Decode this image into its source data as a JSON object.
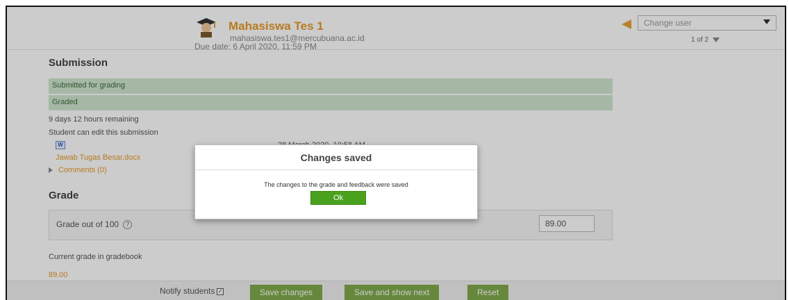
{
  "header": {
    "user_name": "Mahasiswa Tes 1",
    "user_email": "mahasiswa.tes1@mercubuana.ac.id",
    "due_date": "Due date: 6 April 2020, 11:59 PM",
    "change_user_placeholder": "Change user",
    "pager": "1 of 2"
  },
  "submission": {
    "title": "Submission",
    "status_rows": [
      "Submitted for grading",
      "Graded"
    ],
    "time_remaining": "9 days 12 hours remaining",
    "edit_status": "Student can edit this submission",
    "file_date": "28 March 2020, 10:58 AM",
    "file_icon_text": "W",
    "file_name": "Jawab Tugas Besar.docx",
    "comments": "Comments (0)"
  },
  "grade": {
    "title": "Grade",
    "label": "Grade out of 100",
    "help_symbol": "?",
    "value": "89.00",
    "current_label": "Current grade in gradebook",
    "current_value": "89.00"
  },
  "footer": {
    "notify_label": "Notify students",
    "notify_checked": "✓",
    "save_changes": "Save changes",
    "save_and_show_next": "Save and show next",
    "reset": "Reset"
  },
  "modal": {
    "title": "Changes saved",
    "message": "The changes to the grade and feedback were saved",
    "ok": "Ok"
  },
  "colors": {
    "accent": "#e79a2a",
    "button_green": "#80ab4c",
    "ok_green": "#4aa11e",
    "status_green": "#cfe6cf"
  }
}
